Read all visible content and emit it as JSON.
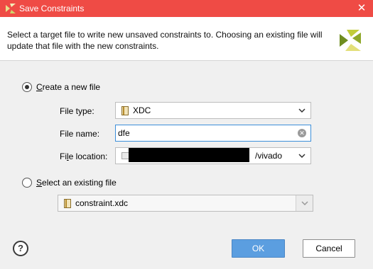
{
  "window": {
    "title": "Save Constraints",
    "close_glyph": "✕"
  },
  "header": {
    "description": "Select a target file to write new unsaved constraints to. Choosing an existing file will update that file with the new constraints."
  },
  "new_file": {
    "radio_label_accel": "C",
    "radio_label_rest": "reate a new file",
    "selected": true,
    "file_type_label": "File type:",
    "file_type_value": "XDC",
    "file_name_label": "File name:",
    "file_name_value": "dfe",
    "file_location_label_pre": "Fi",
    "file_location_label_accel": "l",
    "file_location_label_post": "e location:",
    "file_location_visible_suffix": "/vivado"
  },
  "existing_file": {
    "radio_label_accel": "S",
    "radio_label_rest": "elect an existing file",
    "selected": false,
    "file_value": "constraint.xdc"
  },
  "footer": {
    "help_glyph": "?",
    "ok_label": "OK",
    "cancel_label": "Cancel"
  },
  "colors": {
    "titlebar": "#ef4b45",
    "ok_button": "#5b9ee0",
    "focus_border": "#3c8fd9"
  }
}
